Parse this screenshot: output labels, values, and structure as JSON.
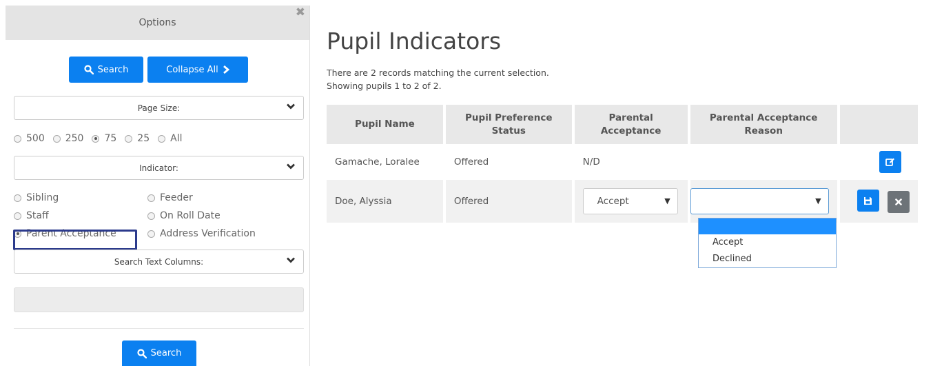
{
  "options_panel": {
    "title": "Options",
    "search_button": "Search",
    "collapse_button": "Collapse All",
    "page_size_label": "Page Size:",
    "page_sizes": [
      {
        "label": "500",
        "checked": false
      },
      {
        "label": "250",
        "checked": false
      },
      {
        "label": "75",
        "checked": true
      },
      {
        "label": "25",
        "checked": false
      },
      {
        "label": "All",
        "checked": false
      }
    ],
    "indicator_label": "Indicator:",
    "indicators_left": [
      {
        "label": "Sibling",
        "checked": false
      },
      {
        "label": "Staff",
        "checked": false
      },
      {
        "label": "Parent Acceptance",
        "checked": true
      }
    ],
    "indicators_right": [
      {
        "label": "Feeder",
        "checked": false
      },
      {
        "label": "On Roll Date",
        "checked": false
      },
      {
        "label": "Address Verification",
        "checked": false
      }
    ],
    "search_text_label": "Search Text Columns:",
    "search_text_value": "",
    "bottom_search_button": "Search"
  },
  "main": {
    "title": "Pupil Indicators",
    "summary_line1": "There are 2 records matching the current selection.",
    "summary_line2": "Showing pupils 1 to 2 of 2.",
    "columns": [
      "Pupil Name",
      "Pupil Preference Status",
      "Parental Acceptance",
      "Parental Acceptance Reason",
      ""
    ],
    "rows": [
      {
        "name": "Gamache, Loralee",
        "status": "Offered",
        "acceptance": "N/D",
        "reason": ""
      },
      {
        "name": "Doe, Alyssia",
        "status": "Offered",
        "acceptance": "Accept",
        "reason": ""
      }
    ],
    "reason_dropdown_options": [
      "",
      "Accept",
      "Declined"
    ]
  },
  "colors": {
    "accent": "#0b80f0",
    "highlight_border": "#2b3a8c",
    "gray_button": "#6d7378"
  },
  "icons": [
    "search-icon",
    "chevron-right-icon",
    "chevron-down-icon",
    "close-icon",
    "edit-icon",
    "save-icon"
  ]
}
